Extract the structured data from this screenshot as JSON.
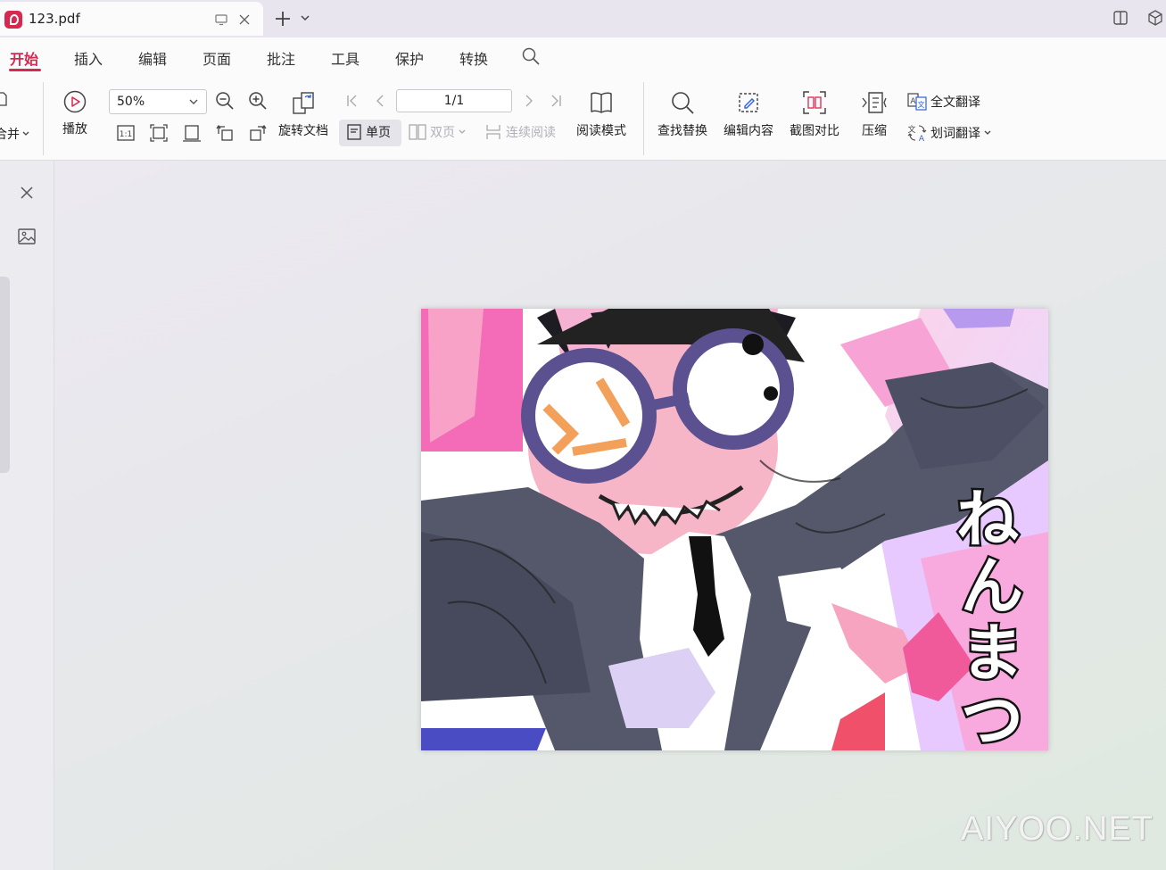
{
  "titlebar": {
    "tab_title": "123.pdf",
    "icons": [
      "monitor-icon",
      "close-icon",
      "plus-icon",
      "chevron-down-icon",
      "layout-icon",
      "cube-icon"
    ]
  },
  "menu": {
    "active": "开始",
    "items": [
      "开始",
      "插入",
      "编辑",
      "页面",
      "批注",
      "工具",
      "保护",
      "转换"
    ]
  },
  "ribbon": {
    "merge_label": "合并",
    "play_label": "播放",
    "zoom_value": "50%",
    "rotate_label": "旋转文档",
    "page_indicator": "1/1",
    "single_page_label": "单页",
    "double_page_label": "双页",
    "continuous_label": "连续阅读",
    "reading_mode_label": "阅读模式",
    "find_replace_label": "查找替换",
    "edit_content_label": "编辑内容",
    "screenshot_compare_label": "截图对比",
    "compress_label": "压缩",
    "full_translate_label": "全文翻译",
    "word_translate_label": "划词翻译"
  },
  "document": {
    "artwork_text": "ねんまつ"
  },
  "watermark": "AIYOO.NET",
  "colors": {
    "accent": "#d7284f",
    "background": "#e9e6ef"
  }
}
